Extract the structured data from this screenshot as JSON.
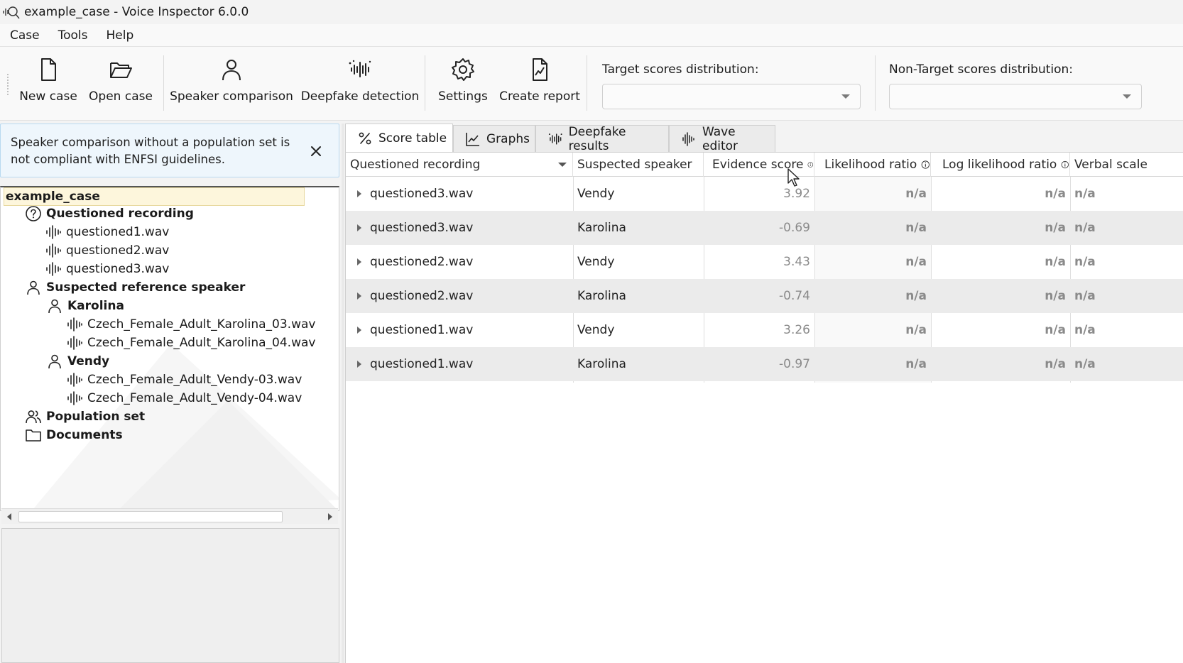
{
  "window": {
    "title": "example_case - Voice Inspector 6.0.0"
  },
  "menu": {
    "items": [
      "Case",
      "Tools",
      "Help"
    ]
  },
  "toolbar": {
    "new_case": "New case",
    "open_case": "Open case",
    "speaker_comparison": "Speaker comparison",
    "deepfake_detection": "Deepfake detection",
    "settings": "Settings",
    "create_report": "Create report",
    "target_dist_label": "Target scores distribution:",
    "target_dist_value": "",
    "nontarget_dist_label": "Non-Target scores distribution:",
    "nontarget_dist_value": ""
  },
  "notice": {
    "text": "Speaker comparison without a population set is not compliant with ENFSI guidelines."
  },
  "tree": {
    "root": "example_case",
    "questioned_label": "Questioned recording",
    "questioned_files": [
      "questioned1.wav",
      "questioned2.wav",
      "questioned3.wav"
    ],
    "reference_label": "Suspected reference speaker",
    "speakers": [
      {
        "name": "Karolina",
        "files": [
          "Czech_Female_Adult_Karolina_03.wav",
          "Czech_Female_Adult_Karolina_04.wav"
        ]
      },
      {
        "name": "Vendy",
        "files": [
          "Czech_Female_Adult_Vendy-03.wav",
          "Czech_Female_Adult_Vendy-04.wav"
        ]
      }
    ],
    "population_label": "Population set",
    "documents_label": "Documents"
  },
  "tabs": {
    "score_table": "Score table",
    "graphs": "Graphs",
    "deepfake_results": "Deepfake results",
    "wave_editor": "Wave editor",
    "active": "score_table"
  },
  "table": {
    "columns": [
      "Questioned recording",
      "Suspected speaker",
      "Evidence score",
      "Likelihood ratio",
      "Log likelihood ratio",
      "Verbal scale"
    ],
    "rows": [
      {
        "recording": "questioned3.wav",
        "speaker": "Vendy",
        "score": "3.92",
        "lr": "n/a",
        "llr": "n/a",
        "verbal": "n/a"
      },
      {
        "recording": "questioned3.wav",
        "speaker": "Karolina",
        "score": "-0.69",
        "lr": "n/a",
        "llr": "n/a",
        "verbal": "n/a"
      },
      {
        "recording": "questioned2.wav",
        "speaker": "Vendy",
        "score": "3.43",
        "lr": "n/a",
        "llr": "n/a",
        "verbal": "n/a"
      },
      {
        "recording": "questioned2.wav",
        "speaker": "Karolina",
        "score": "-0.74",
        "lr": "n/a",
        "llr": "n/a",
        "verbal": "n/a"
      },
      {
        "recording": "questioned1.wav",
        "speaker": "Vendy",
        "score": "3.26",
        "lr": "n/a",
        "llr": "n/a",
        "verbal": "n/a"
      },
      {
        "recording": "questioned1.wav",
        "speaker": "Karolina",
        "score": "-0.97",
        "lr": "n/a",
        "llr": "n/a",
        "verbal": "n/a"
      }
    ]
  },
  "colors": {
    "notice_bg": "#eef6fc",
    "notice_border": "#b8d9f0",
    "root_highlight": "#fdf6dc",
    "alt_row": "#ebebeb"
  }
}
